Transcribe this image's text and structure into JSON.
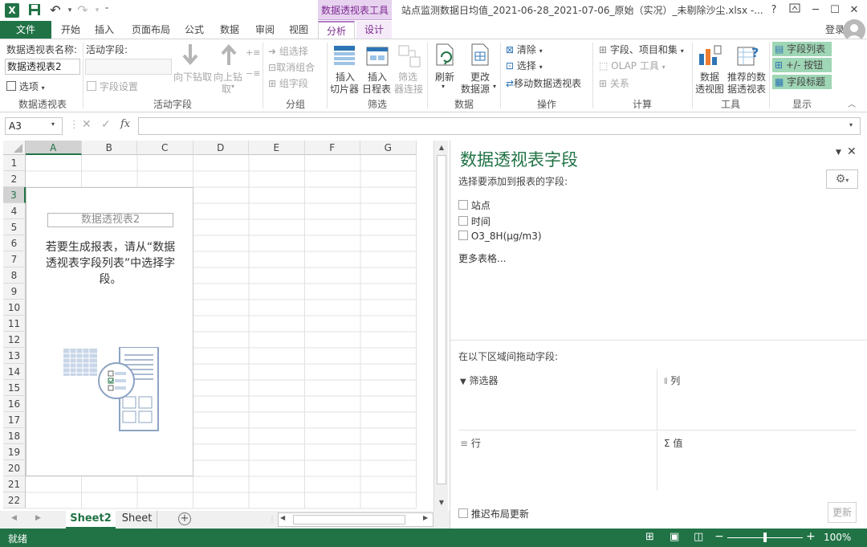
{
  "titlebar": {
    "context_tools": "数据透视表工具",
    "doc_title": "站点监测数据日均值_2021-06-28_2021-07-06_原始（实况）_未剔除沙尘.xlsx -...",
    "help": "?"
  },
  "tabs": {
    "file": "文件",
    "items": [
      "开始",
      "插入",
      "页面布局",
      "公式",
      "数据",
      "审阅",
      "视图"
    ],
    "analyze": "分析",
    "design": "设计",
    "login": "登录"
  },
  "ribbon": {
    "pivot_group": {
      "name_label": "数据透视表名称:",
      "name_value": "数据透视表2",
      "options": "选项",
      "label": "数据透视表"
    },
    "active_field_group": {
      "active_field_label": "活动字段:",
      "field_settings": "字段设置",
      "drill_down": "向下钻取",
      "drill_up_1": "向上钻",
      "drill_up_2": "取",
      "label": "活动字段"
    },
    "group_group": {
      "group_selection": "组选择",
      "ungroup": "取消组合",
      "group_field": "组字段",
      "label": "分组"
    },
    "filter_group": {
      "insert_slicer_1": "插入",
      "insert_slicer_2": "切片器",
      "insert_timeline_1": "插入",
      "insert_timeline_2": "日程表",
      "filter_conn_1": "筛选",
      "filter_conn_2": "器连接",
      "label": "筛选"
    },
    "data_group": {
      "refresh": "刷新",
      "change_source_1": "更改",
      "change_source_2": "数据源",
      "label": "数据"
    },
    "actions_group": {
      "clear": "清除",
      "select": "选择",
      "move": "移动数据透视表",
      "label": "操作"
    },
    "calc_group": {
      "fields_items": "字段、项目和集",
      "olap": "OLAP 工具",
      "relations": "关系",
      "label": "计算"
    },
    "tools_group": {
      "pivotchart_1": "数据",
      "pivotchart_2": "透视图",
      "recommended_1": "推荐的数",
      "recommended_2": "据透视表",
      "label": "工具"
    },
    "show_group": {
      "field_list": "字段列表",
      "buttons": "+/- 按钮",
      "headers": "字段标题",
      "label": "显示"
    }
  },
  "formula_bar": {
    "name_box": "A3",
    "fx": "fx"
  },
  "grid": {
    "columns": [
      "A",
      "B",
      "C",
      "D",
      "E",
      "F",
      "G"
    ],
    "rows": [
      "1",
      "2",
      "3",
      "4",
      "5",
      "6",
      "7",
      "8",
      "9",
      "10",
      "11",
      "12",
      "13",
      "14",
      "15",
      "16",
      "17",
      "18",
      "19",
      "20",
      "21",
      "22"
    ],
    "selected_cell": "A3"
  },
  "pivot_placeholder": {
    "name": "数据透视表2",
    "line1": "若要生成报表，请从“数据",
    "line2": "透视表字段列表”中选择字",
    "line3": "段。"
  },
  "sheets": {
    "tabs": [
      "Sheet2",
      "Sheet"
    ],
    "active": "Sheet2"
  },
  "field_pane": {
    "title": "数据透视表字段",
    "choose_label": "选择要添加到报表的字段:",
    "fields": [
      "站点",
      "时间",
      "O3_8H(μg/m3)"
    ],
    "more_tables": "更多表格...",
    "drag_label": "在以下区域间拖动字段:",
    "areas": {
      "filters": "筛选器",
      "columns": "列",
      "rows": "行",
      "values": "值"
    },
    "defer_label": "推迟布局更新",
    "update_button": "更新"
  },
  "status": {
    "ready": "就绪",
    "zoom": "100%",
    "zoom_fraction": 0.5
  },
  "colors": {
    "excel_green": "#217346",
    "context_purple": "#7d2a90",
    "highlight": "#9fd6b5"
  }
}
